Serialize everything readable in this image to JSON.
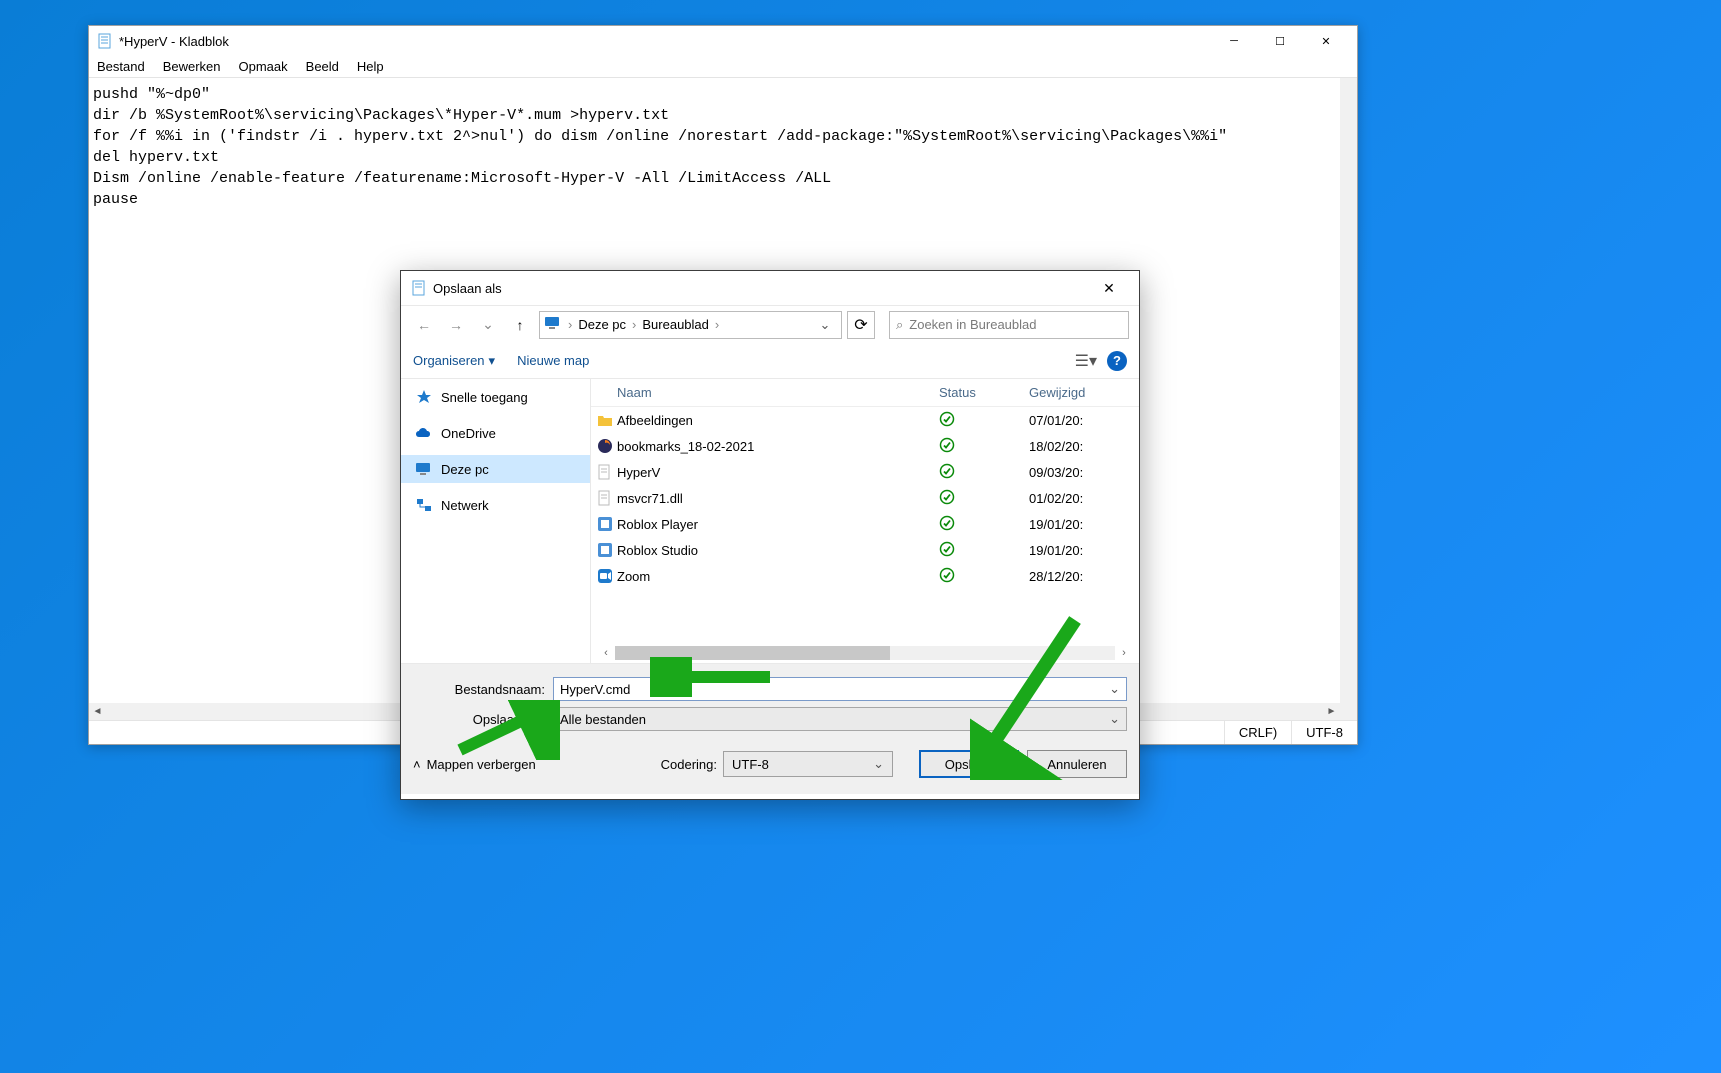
{
  "notepad": {
    "title": "*HyperV - Kladblok",
    "menu": {
      "file": "Bestand",
      "edit": "Bewerken",
      "format": "Opmaak",
      "view": "Beeld",
      "help": "Help"
    },
    "text": "pushd \"%~dp0\"\ndir /b %SystemRoot%\\servicing\\Packages\\*Hyper-V*.mum >hyperv.txt\nfor /f %%i in ('findstr /i . hyperv.txt 2^>nul') do dism /online /norestart /add-package:\"%SystemRoot%\\servicing\\Packages\\%%i\"\ndel hyperv.txt\nDism /online /enable-feature /featurename:Microsoft-Hyper-V -All /LimitAccess /ALL\npause",
    "status": {
      "crlf": "CRLF)",
      "encoding": "UTF-8"
    }
  },
  "saveas": {
    "title": "Opslaan als",
    "breadcrumb": {
      "root": "Deze pc",
      "leaf": "Bureaublad"
    },
    "search_placeholder": "Zoeken in Bureaublad",
    "toolbar": {
      "organize": "Organiseren",
      "newfolder": "Nieuwe map"
    },
    "side": {
      "quick": "Snelle toegang",
      "onedrive": "OneDrive",
      "thispc": "Deze pc",
      "network": "Netwerk"
    },
    "cols": {
      "name": "Naam",
      "status": "Status",
      "date": "Gewijzigd"
    },
    "rows": [
      {
        "icon": "folder",
        "name": "Afbeeldingen",
        "date": "07/01/20:"
      },
      {
        "icon": "firefox",
        "name": "bookmarks_18-02-2021",
        "date": "18/02/20:"
      },
      {
        "icon": "file",
        "name": "HyperV",
        "date": "09/03/20:"
      },
      {
        "icon": "file",
        "name": "msvcr71.dll",
        "date": "01/02/20:"
      },
      {
        "icon": "app",
        "name": "Roblox Player",
        "date": "19/01/20:"
      },
      {
        "icon": "app",
        "name": "Roblox Studio",
        "date": "19/01/20:"
      },
      {
        "icon": "zoom",
        "name": "Zoom",
        "date": "28/12/20:"
      }
    ],
    "form": {
      "filename_label": "Bestandsnaam:",
      "filename_value": "HyperV.cmd",
      "type_label": "Opslaan als:",
      "type_value": "Alle bestanden"
    },
    "footer": {
      "hide": "Mappen verbergen",
      "encoding_label": "Codering:",
      "encoding_value": "UTF-8",
      "save": "Opslaan",
      "cancel": "Annuleren"
    },
    "status_glyph": "✓"
  }
}
